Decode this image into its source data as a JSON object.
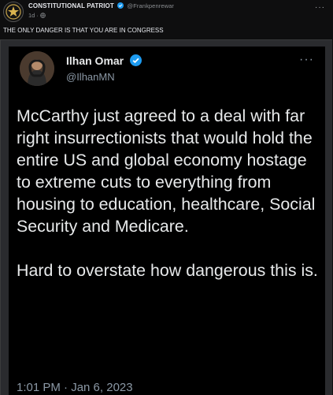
{
  "post": {
    "author": "CONSTITUTIONAL PATRIOT",
    "handle": "@Frankpenrewar",
    "time": "1d ·",
    "more": "···",
    "caption": "THE ONLY DANGER IS THAT YOU ARE IN CONGRESS"
  },
  "tweet": {
    "name": "Ilhan Omar",
    "handle": "@IlhanMN",
    "more": "···",
    "paragraph1": "McCarthy just agreed to a deal with far right insurrectionists that would hold the entire US and global economy hostage to extreme cuts to everything from housing to education, healthcare, Social Security and Medicare.",
    "paragraph2": "Hard to overstate how dangerous this is.",
    "timestamp": "1:01 PM · Jan 6, 2023"
  },
  "colors": {
    "verified": "#1d9bf0",
    "background": "#000000"
  },
  "icons": [
    "verified-icon",
    "globe-icon",
    "more-icon"
  ]
}
